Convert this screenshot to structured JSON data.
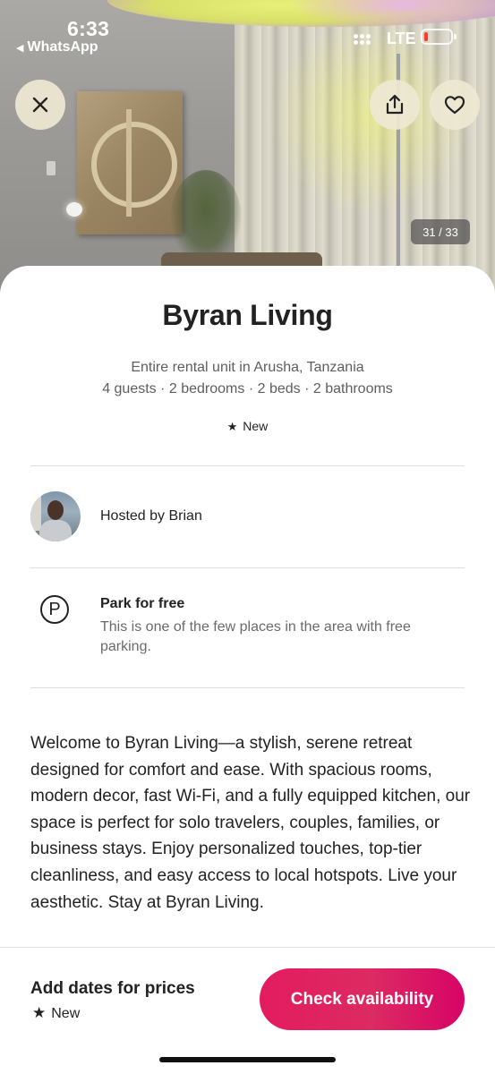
{
  "status_bar": {
    "time": "6:33",
    "back_app": "WhatsApp",
    "network": "LTE",
    "battery_color": "#ff3b30"
  },
  "hero": {
    "photo_counter": "31 / 33",
    "icons": {
      "close": "close-icon",
      "share": "share-icon",
      "favorite": "heart-icon"
    }
  },
  "listing": {
    "title": "Byran Living",
    "subtitle": "Entire rental unit in Arusha, Tanzania",
    "details": "4 guests · 2 bedrooms · 2 beds · 2 bathrooms",
    "badge": "New"
  },
  "host": {
    "label": "Hosted by Brian"
  },
  "feature": {
    "icon_letter": "P",
    "title": "Park for free",
    "description": "This is one of the few places in the area with free parking."
  },
  "description": "Welcome to Byran Living—a stylish, serene retreat designed for comfort and ease. With spacious rooms, modern decor, fast Wi-Fi, and a fully equipped kitchen, our space is perfect for solo travelers, couples, families, or business stays. Enjoy personalized touches, top-tier cleanliness, and easy access to local hotspots. Live your aesthetic. Stay at Byran Living.",
  "footer": {
    "price_label": "Add dates for prices",
    "badge": "New",
    "cta_label": "Check availability",
    "cta_color": "#e31c5f"
  }
}
